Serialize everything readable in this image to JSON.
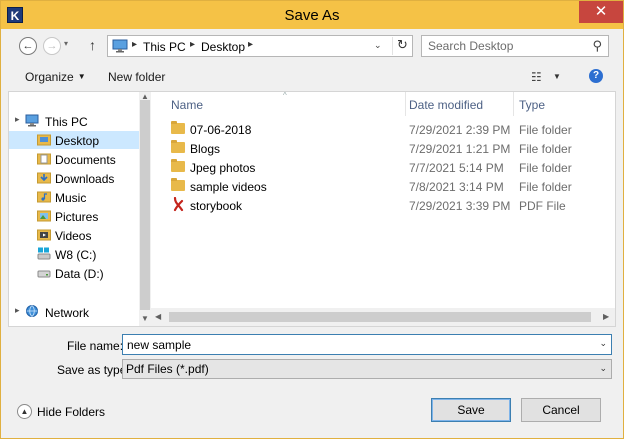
{
  "window": {
    "title": "Save As",
    "app_icon_letter": "K",
    "close_glyph": "✕"
  },
  "nav": {
    "back_glyph": "←",
    "forward_glyph": "→",
    "recent_glyph": "▾",
    "up_glyph": "↑",
    "breadcrumb": [
      "This PC",
      "Desktop"
    ],
    "sep_glyph": "▸",
    "dropdown_glyph": "⌄",
    "refresh_glyph": "↻",
    "search_placeholder": "Search Desktop",
    "search_glyph": "⚲"
  },
  "toolbar": {
    "organize_label": "Organize",
    "organize_caret": "▼",
    "new_folder_label": "New folder",
    "view_glyph": "☷",
    "view_caret": "▼",
    "help_glyph": "?"
  },
  "sidebar": {
    "items": [
      {
        "label": "This PC",
        "icon": "computer-icon"
      },
      {
        "label": "Desktop",
        "icon": "desktop-folder-icon",
        "selected": true
      },
      {
        "label": "Documents",
        "icon": "documents-folder-icon"
      },
      {
        "label": "Downloads",
        "icon": "downloads-folder-icon"
      },
      {
        "label": "Music",
        "icon": "music-folder-icon"
      },
      {
        "label": "Pictures",
        "icon": "pictures-folder-icon"
      },
      {
        "label": "Videos",
        "icon": "videos-folder-icon"
      },
      {
        "label": "W8 (C:)",
        "icon": "system-drive-icon"
      },
      {
        "label": "Data (D:)",
        "icon": "drive-icon"
      },
      {
        "label": "Network",
        "icon": "network-icon"
      }
    ],
    "expand_glyph": "▸"
  },
  "files": {
    "columns": {
      "name": "Name",
      "date": "Date modified",
      "type": "Type"
    },
    "sort_glyph": "^",
    "rows": [
      {
        "name": "07-06-2018",
        "date": "7/29/2021 2:39 PM",
        "type": "File folder",
        "icon": "folder-icon"
      },
      {
        "name": "Blogs",
        "date": "7/29/2021 1:21 PM",
        "type": "File folder",
        "icon": "folder-icon"
      },
      {
        "name": "Jpeg photos",
        "date": "7/7/2021 5:14 PM",
        "type": "File folder",
        "icon": "folder-icon"
      },
      {
        "name": "sample videos",
        "date": "7/8/2021 3:14 PM",
        "type": "File folder",
        "icon": "folder-icon"
      },
      {
        "name": "storybook",
        "date": "7/29/2021 3:39 PM",
        "type": "PDF File",
        "icon": "pdf-icon"
      }
    ]
  },
  "form": {
    "file_name_label": "File name:",
    "file_name_value": "new sample",
    "save_as_type_label": "Save as type:",
    "save_as_type_value": "Pdf Files (*.pdf)",
    "caret_glyph": "⌄"
  },
  "footer": {
    "hide_folders_label": "Hide Folders",
    "hide_folders_glyph": "▲",
    "save_label": "Save",
    "cancel_label": "Cancel"
  },
  "colors": {
    "titlebar": "#f5c246",
    "close_button": "#c7463e",
    "selection": "#cce8ff",
    "column_header_text": "#4d6185",
    "folder": "#e8b94a",
    "pdf": "#c4241c"
  }
}
